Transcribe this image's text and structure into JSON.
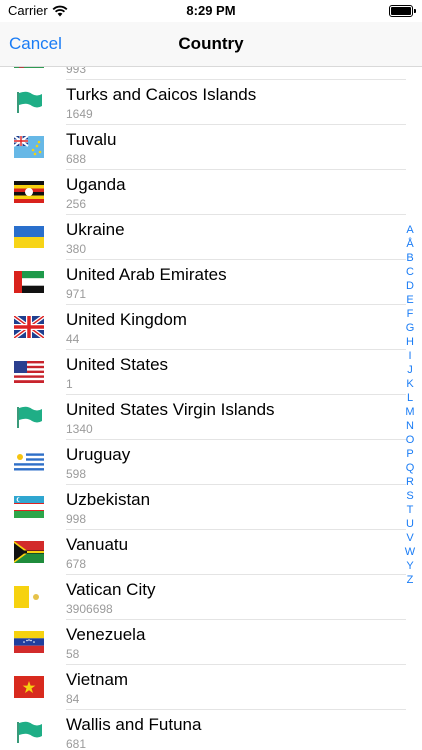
{
  "status_bar": {
    "carrier": "Carrier",
    "time": "8:29 PM"
  },
  "nav": {
    "cancel_label": "Cancel",
    "title": "Country"
  },
  "countries": [
    {
      "name": "",
      "code": "993",
      "flag": "turkmenistan-flag-icon"
    },
    {
      "name": "Turks and Caicos Islands",
      "code": "1649",
      "flag": "generic-flag-icon"
    },
    {
      "name": "Tuvalu",
      "code": "688",
      "flag": "tuvalu-flag-icon"
    },
    {
      "name": "Uganda",
      "code": "256",
      "flag": "uganda-flag-icon"
    },
    {
      "name": "Ukraine",
      "code": "380",
      "flag": "ukraine-flag-icon"
    },
    {
      "name": "United Arab Emirates",
      "code": "971",
      "flag": "uae-flag-icon"
    },
    {
      "name": "United Kingdom",
      "code": "44",
      "flag": "uk-flag-icon"
    },
    {
      "name": "United States",
      "code": "1",
      "flag": "us-flag-icon"
    },
    {
      "name": "United States Virgin Islands",
      "code": "1340",
      "flag": "generic-flag-icon"
    },
    {
      "name": "Uruguay",
      "code": "598",
      "flag": "uruguay-flag-icon"
    },
    {
      "name": "Uzbekistan",
      "code": "998",
      "flag": "uzbekistan-flag-icon"
    },
    {
      "name": "Vanuatu",
      "code": "678",
      "flag": "vanuatu-flag-icon"
    },
    {
      "name": "Vatican City",
      "code": "3906698",
      "flag": "vatican-flag-icon"
    },
    {
      "name": "Venezuela",
      "code": "58",
      "flag": "venezuela-flag-icon"
    },
    {
      "name": "Vietnam",
      "code": "84",
      "flag": "vietnam-flag-icon"
    },
    {
      "name": "Wallis and Futuna",
      "code": "681",
      "flag": "generic-flag-icon"
    }
  ],
  "index_letters": [
    "A",
    "Å",
    "B",
    "C",
    "D",
    "E",
    "F",
    "G",
    "H",
    "I",
    "J",
    "K",
    "L",
    "M",
    "N",
    "O",
    "P",
    "Q",
    "R",
    "S",
    "T",
    "U",
    "V",
    "W",
    "Y",
    "Z"
  ],
  "colors": {
    "accent": "#1a7cf5",
    "secondary_text": "#9b9b9b",
    "separator": "#e4e4e4"
  }
}
